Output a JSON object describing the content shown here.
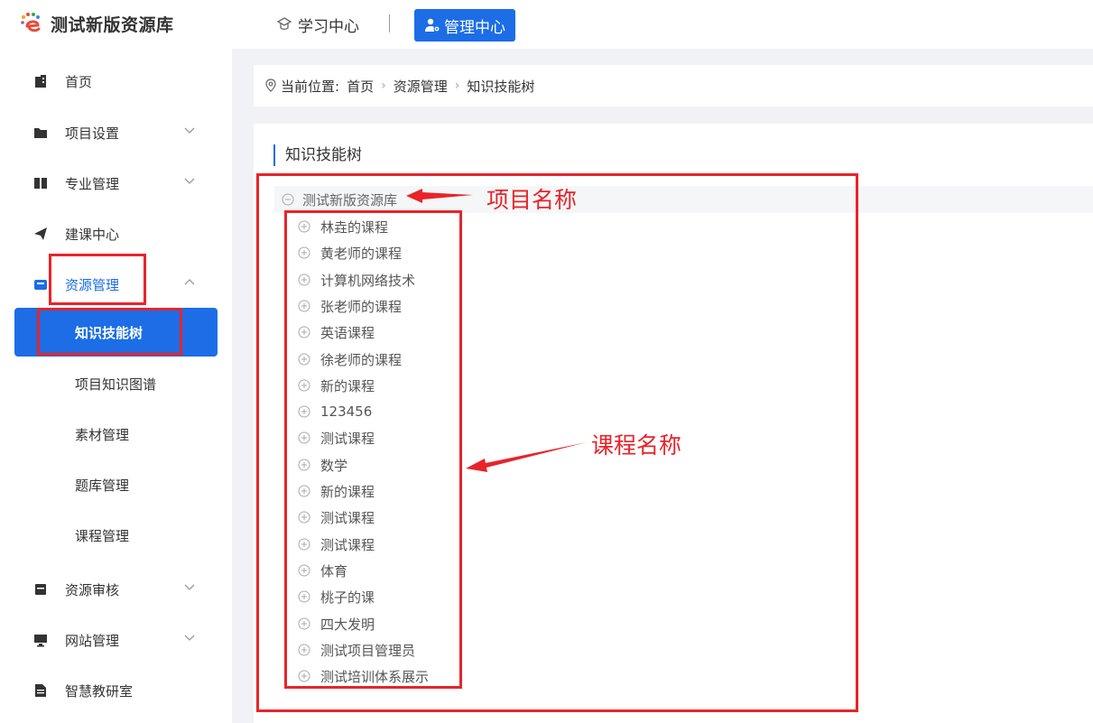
{
  "header": {
    "logo_text": "测试新版资源库",
    "nav_study": "学习中心",
    "nav_admin": "管理中心"
  },
  "sidebar": {
    "items": [
      {
        "label": "首页",
        "icon": "building-icon"
      },
      {
        "label": "项目设置",
        "icon": "folder-icon"
      },
      {
        "label": "专业管理",
        "icon": "book-icon"
      },
      {
        "label": "建课中心",
        "icon": "paper-plane-icon"
      },
      {
        "label": "资源管理",
        "icon": "box-icon"
      },
      {
        "label": "资源审核",
        "icon": "document-icon"
      },
      {
        "label": "网站管理",
        "icon": "monitor-icon"
      },
      {
        "label": "智慧教研室",
        "icon": "file-text-icon"
      }
    ],
    "sub_items": [
      {
        "label": "知识技能树"
      },
      {
        "label": "项目知识图谱"
      },
      {
        "label": "素材管理"
      },
      {
        "label": "题库管理"
      },
      {
        "label": "课程管理"
      }
    ]
  },
  "breadcrumb": {
    "prefix": "当前位置:",
    "items": [
      "首页",
      "资源管理",
      "知识技能树"
    ]
  },
  "panel": {
    "title": "知识技能树",
    "tree": {
      "root": "测试新版资源库",
      "children": [
        "林垚的课程",
        "黄老师的课程",
        "计算机网络技术",
        "张老师的课程",
        "英语课程",
        "徐老师的课程",
        "新的课程",
        "123456",
        "测试课程",
        "数学",
        "新的课程",
        "测试课程",
        "测试课程",
        "体育",
        "桃子的课",
        "四大发明",
        "测试项目管理员",
        "测试培训体系展示"
      ]
    }
  },
  "annotations": {
    "project_name": "项目名称",
    "course_name": "课程名称"
  },
  "colors": {
    "primary": "#1c6de6",
    "annotation_red": "#e8242a"
  }
}
